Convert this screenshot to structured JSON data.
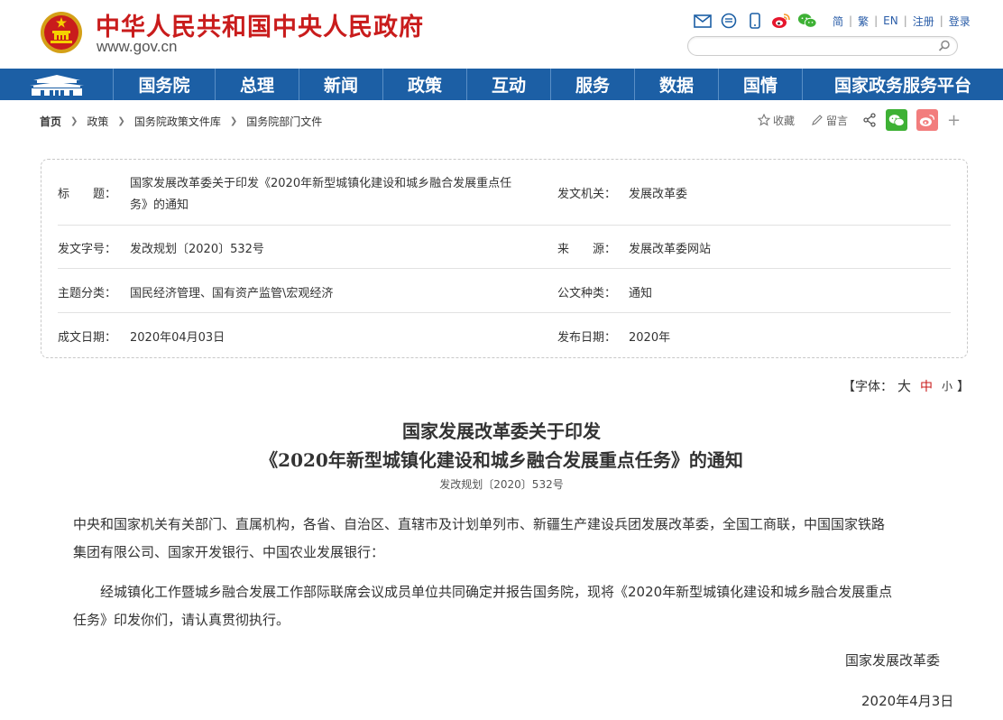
{
  "header": {
    "site_title": "中华人民共和国中央人民政府",
    "site_url": "www.gov.cn",
    "icons": [
      "mail-icon",
      "message-icon",
      "mobile-icon",
      "weibo-icon",
      "wechat-icon"
    ],
    "lang_links": [
      "简",
      "繁",
      "EN",
      "注册",
      "登录"
    ],
    "search_placeholder": ""
  },
  "nav": {
    "items": [
      "国务院",
      "总理",
      "新闻",
      "政策",
      "互动",
      "服务",
      "数据",
      "国情",
      "国家政务服务平台"
    ]
  },
  "breadcrumb": [
    "首页",
    "政策",
    "国务院政策文件库",
    "国务院部门文件"
  ],
  "share": {
    "favorite_label": "收藏",
    "comment_label": "留言"
  },
  "info": {
    "title_label": "标　　题：",
    "title_value_line1": "国家发展改革委关于印发《2020年新型城镇化建设和城乡融合发展重点任",
    "title_value_line2": "务》的通知",
    "issuer_label": "发文机关：",
    "issuer_value": "发展改革委",
    "docno_label": "发文字号：",
    "docno_value": "发改规划〔2020〕532号",
    "source_label": "来　　源：",
    "source_value": "发展改革委网站",
    "topic_label": "主题分类：",
    "topic_value": "国民经济管理、国有资产监管\\宏观经济",
    "type_label": "公文种类：",
    "type_value": "通知",
    "written_label": "成文日期：",
    "written_value": "2020年04月03日",
    "published_label": "发布日期：",
    "published_value": "2020年"
  },
  "font_size": {
    "prefix": "【字体：",
    "large": "大",
    "medium": "中",
    "small": "小",
    "suffix": "】"
  },
  "article": {
    "title_line1": "国家发展改革委关于印发",
    "title_line2": "《2020年新型城镇化建设和城乡融合发展重点任务》的通知",
    "doc_number": "发改规划〔2020〕532号",
    "para1_line1": "中央和国家机关有关部门、直属机构，各省、自治区、直辖市及计划单列市、新疆生产建设兵团发展改革委，全国工商联，中国国家铁路",
    "para1_line2": "集团有限公司、国家开发银行、中国农业发展银行：",
    "para2_line1": "　　经城镇化工作暨城乡融合发展工作部际联席会议成员单位共同确定并报告国务院，现将《2020年新型城镇化建设和城乡融合发展重点",
    "para2_line2": "任务》印发你们，请认真贯彻执行。",
    "signature": "国家发展改革委",
    "date": "2020年4月3日"
  },
  "colors": {
    "brand_red": "#c91c1c",
    "nav_blue": "#1c5fa5",
    "link_blue": "#2a5da8"
  }
}
